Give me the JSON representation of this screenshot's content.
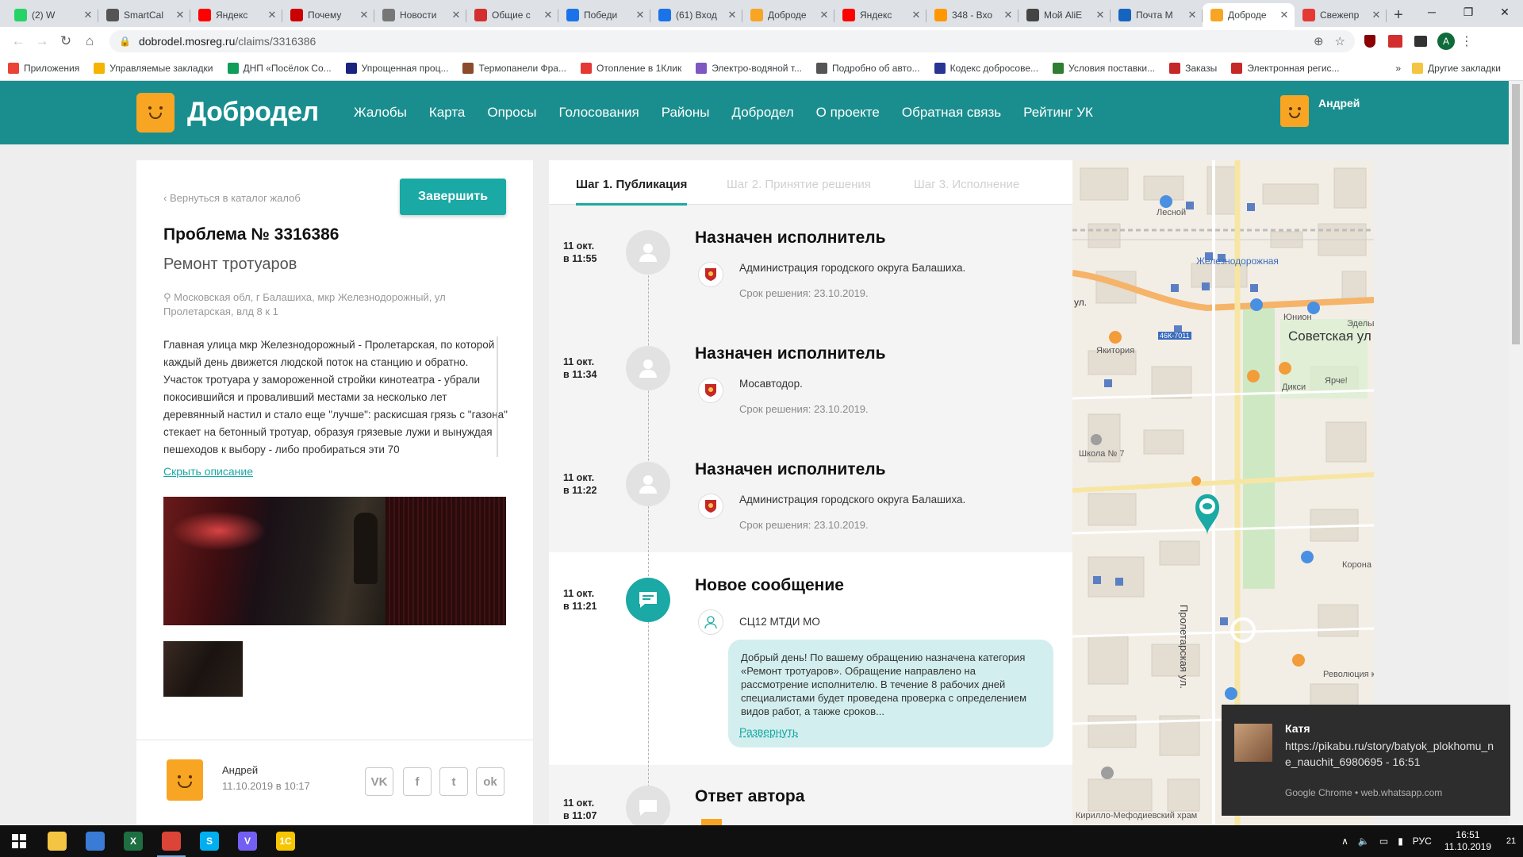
{
  "browser": {
    "tabs": [
      {
        "title": "(2) W",
        "color": "#25d366",
        "icon": "whatsapp-icon"
      },
      {
        "title": "SmartCal",
        "color": "#555555",
        "icon": "chart-icon"
      },
      {
        "title": "Яндекс",
        "color": "#ff0000",
        "icon": "yandex-icon"
      },
      {
        "title": "Почему",
        "color": "#cc0000",
        "icon": "pikabu-icon"
      },
      {
        "title": "Новости",
        "color": "#777777",
        "icon": "news-icon"
      },
      {
        "title": "Общие с",
        "color": "#d32f2f",
        "icon": "service-icon"
      },
      {
        "title": "Победи",
        "color": "#1a73e8",
        "icon": "mail-icon"
      },
      {
        "title": "(61) Вход",
        "color": "#1a73e8",
        "icon": "mail-icon"
      },
      {
        "title": "Доброде",
        "color": "#f8a523",
        "icon": "dobrodel-icon"
      },
      {
        "title": "Яндекс",
        "color": "#ff0000",
        "icon": "yandex-icon"
      },
      {
        "title": "348 - Вхо",
        "color": "#ff9800",
        "icon": "mail-icon"
      },
      {
        "title": "Мой AliE",
        "color": "#444444",
        "icon": "aliexpress-icon"
      },
      {
        "title": "Почта М",
        "color": "#1565c0",
        "icon": "mail-icon"
      },
      {
        "title": "Доброде",
        "color": "#f8a523",
        "icon": "dobrodel-icon",
        "active": true
      },
      {
        "title": "Свежепр",
        "color": "#e53935",
        "icon": "pikabu-icon"
      }
    ],
    "url_host": "dobrodel.mosreg.ru",
    "url_path": "/claims/3316386",
    "profile_initial": "A",
    "bookmarks": [
      {
        "label": "Приложения",
        "color": "#ea4335"
      },
      {
        "label": "Управляемые закладки",
        "color": "#f4b400"
      },
      {
        "label": "ДНП «Посёлок Со...",
        "color": "#0f9d58"
      },
      {
        "label": "Упрощенная проц...",
        "color": "#1a237e"
      },
      {
        "label": "Термопанели Фра...",
        "color": "#8d4b2b"
      },
      {
        "label": "Отопление в 1Клик",
        "color": "#e53935"
      },
      {
        "label": "Электро-водяной т...",
        "color": "#7e57c2"
      },
      {
        "label": "Подробно об авто...",
        "color": "#555555"
      },
      {
        "label": "Кодекс добросове...",
        "color": "#283593"
      },
      {
        "label": "Условия поставки...",
        "color": "#2e7d32"
      },
      {
        "label": "Заказы",
        "color": "#c62828"
      },
      {
        "label": "Электронная регис...",
        "color": "#c62828"
      }
    ],
    "bookmarks_more": "»",
    "other_bookmarks": "Другие закладки"
  },
  "site": {
    "logo": "Добродел",
    "nav": [
      "Жалобы",
      "Карта",
      "Опросы",
      "Голосования",
      "Районы",
      "Добродел",
      "О проекте",
      "Обратная связь",
      "Рейтинг УК"
    ],
    "user_name": "Андрей"
  },
  "claim": {
    "back_link": "Вернуться в каталог жалоб",
    "finish_button": "Завершить",
    "title": "Проблема № 3316386",
    "category": "Ремонт тротуаров",
    "address": "Московская обл, г Балашиха, мкр Железнодорожный, ул Пролетарская, влд 8 к 1",
    "description": "Главная улица мкр Железнодорожный - Пролетарская, по которой каждый день движется людской поток на станцию и обратно. Участок тротуара у замороженной стройки кинотеатра - убрали покосившийся и проваливший местами за несколько лет деревянный настил и стало еще \"лучше\": раскисшая грязь с \"газона\" стекает на бетонный тротуар, образуя грязевые лужи и вынуждая пешеходов к выбору - либо пробираться эти 70",
    "hide_description": "Скрыть описание",
    "author_name": "Андрей",
    "author_date": "11.10.2019 в 10:17",
    "social": [
      "VK",
      "f",
      "t",
      "ok"
    ]
  },
  "timeline": {
    "steps": [
      "Шаг 1. Публикация",
      "Шаг 2. Принятие решения",
      "Шаг 3. Исполнение"
    ],
    "events": [
      {
        "date": "11 окт.",
        "time": "в 11:55",
        "title": "Назначен исполнитель",
        "org": "Администрация городского округа Балашиха.",
        "term": "Срок решения: 23.10.2019."
      },
      {
        "date": "11 окт.",
        "time": "в 11:34",
        "title": "Назначен исполнитель",
        "org": "Мосавтодор.",
        "term": "Срок решения: 23.10.2019."
      },
      {
        "date": "11 окт.",
        "time": "в 11:22",
        "title": "Назначен исполнитель",
        "org": "Администрация городского округа Балашиха.",
        "term": "Срок решения: 23.10.2019."
      },
      {
        "date": "11 окт.",
        "time": "в 11:21",
        "title": "Новое сообщение",
        "org": "СЦ12 МТДИ МО",
        "message": "Добрый день! По вашему обращению назначена категория «Ремонт тротуаров». Обращение направлено на рассмотрение исполнителю. В течение 8 рабочих дней специалистами будет проведена проверка с определением видов работ, а также сроков...",
        "more": "Развернуть"
      },
      {
        "date": "11 окт.",
        "time": "в 11:07",
        "title": "Ответ автора"
      }
    ]
  },
  "map": {
    "labels": [
      "Лесной",
      "Железнодорожная",
      "Юнион",
      "Эдельв",
      "Якитория",
      "46К-7011",
      "Советская ул",
      "Дикси",
      "Ярче!",
      "Школа № 7",
      "Корона",
      "Пролетарская ул.",
      "Революция коф",
      "Кирилло-Мефодиевский храм",
      "ул."
    ]
  },
  "notification": {
    "name": "Катя",
    "text": "https://pikabu.ru/story/batyok_plokhomu_ne_nauchit_6980695 - 16:51",
    "source": "Google Chrome • web.whatsapp.com"
  },
  "taskbar": {
    "apps": [
      {
        "name": "explorer",
        "color": "#f4c542",
        "label": ""
      },
      {
        "name": "box",
        "color": "#3a7bd5",
        "label": ""
      },
      {
        "name": "excel",
        "color": "#1d6f42",
        "label": "X"
      },
      {
        "name": "chrome",
        "color": "#db4437",
        "label": "",
        "active": true
      },
      {
        "name": "skype",
        "color": "#00aff0",
        "label": "S"
      },
      {
        "name": "viber",
        "color": "#7360f2",
        "label": "V"
      },
      {
        "name": "1c",
        "color": "#f7c600",
        "label": "1С"
      }
    ],
    "lang": "РУС",
    "time": "16:51",
    "date": "11.10.2019",
    "notif_count": "21"
  }
}
